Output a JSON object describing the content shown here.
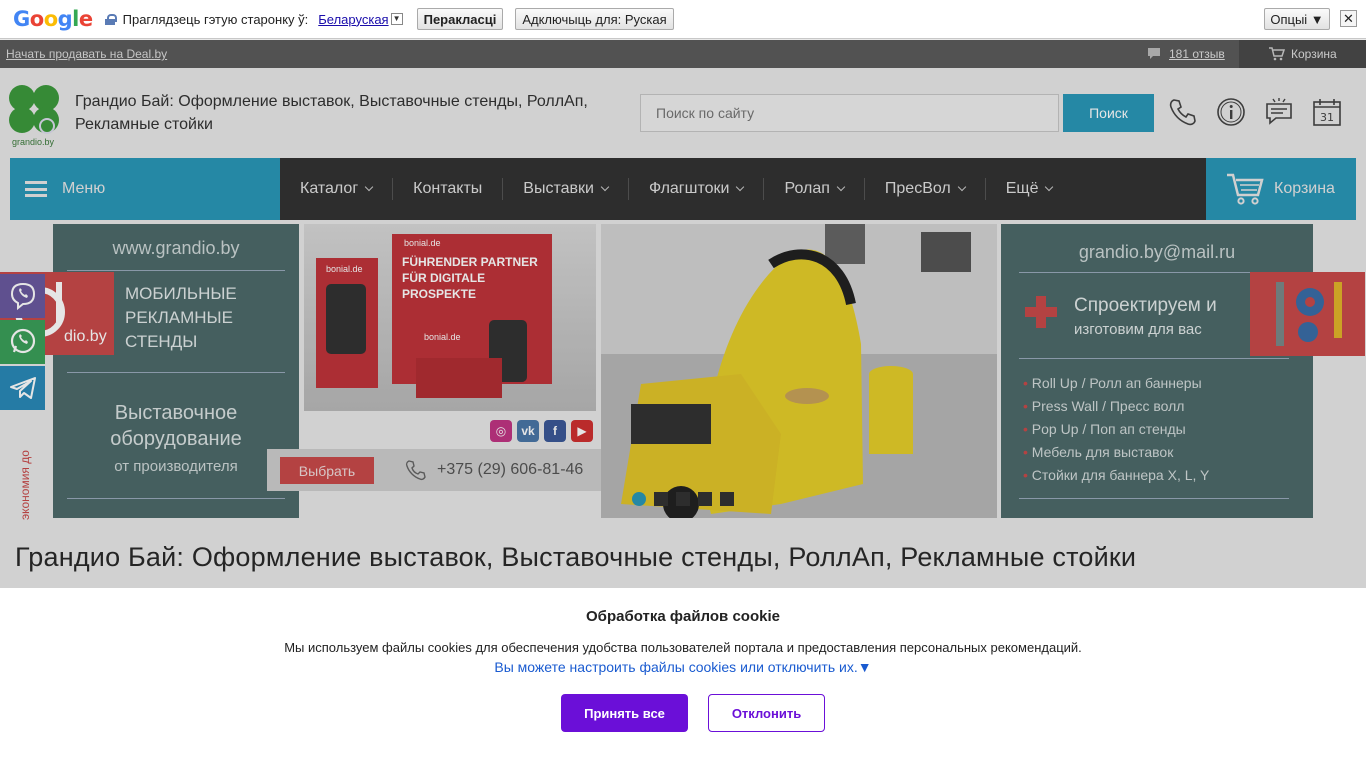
{
  "translate_bar": {
    "logo": "Google",
    "prompt": "Праглядзець гэтую старонку ў:",
    "language": "Беларуская",
    "translate_btn": "Перакласці",
    "disable_btn": "Адключыць для: Руская",
    "options_btn": "Опцыі ▼",
    "close": "✕"
  },
  "top_strip": {
    "sell_link": "Начать продавать на Deal.by",
    "reviews": "181 отзыв",
    "cart": "Корзина"
  },
  "header": {
    "logo_caption": "grandio.by",
    "title": "Грандио Бай: Оформление выставок, Выставочные стенды, РоллАп, Рекламные стойки",
    "search_placeholder": "Поиск по сайту",
    "search_button": "Поиск",
    "calendar_day": "31"
  },
  "nav": {
    "menu": "Меню",
    "items": [
      {
        "label": "Каталог",
        "dropdown": true
      },
      {
        "label": "Контакты",
        "dropdown": false
      },
      {
        "label": "Выставки",
        "dropdown": true
      },
      {
        "label": "Флагштоки",
        "dropdown": true
      },
      {
        "label": "Ролап",
        "dropdown": true
      },
      {
        "label": "ПресВол",
        "dropdown": true
      },
      {
        "label": "Ещё",
        "dropdown": true
      }
    ],
    "cart": "Корзина"
  },
  "banner": {
    "left_url": "www.grandio.by",
    "logo_text": "dio.by",
    "mobile": [
      "МОБИЛЬНЫЕ",
      "РЕКЛАМНЫЕ",
      "СТЕНДЫ"
    ],
    "equip_line1": "Выставочное",
    "equip_line2": "оборудование",
    "equip_line3": "от производителя",
    "photo_brand": "bonial.de",
    "photo_headline": "FÜHRENDER PARTNER FÜR DIGITALE PROSPEKTE",
    "cta": "Выбрать",
    "phone": "+375 (29) 606-81-46",
    "side_text": "экономия до",
    "right_email": "grandio.by@mail.ru",
    "proj_line1": "Спроектируем и",
    "proj_line2": "изготовим для вас",
    "services": [
      "Roll Up / Ролл ап баннеры",
      "Press Wall / Пресс волл",
      "Pop Up / Поп ап стенды",
      "Мебель для выставок",
      "Стойки для баннера X, L, Y"
    ],
    "slides": 5,
    "active_slide": 1
  },
  "page_title": "Грандио Бай: Оформление выставок, Выставочные стенды, РоллАп, Рекламные стойки",
  "cookie": {
    "title": "Обработка файлов cookie",
    "text": "Мы используем файлы cookies для обеспечения удобства пользователей портала и предоставления персональных рекомендаций.",
    "link": "Вы можете настроить файлы cookies или отключить их.▼",
    "accept": "Принять все",
    "decline": "Отклонить"
  },
  "colors": {
    "accent": "#2a98b8",
    "nav_dark": "#333333",
    "banner_teal": "#4d6a6a",
    "banner_red": "#c94a4a",
    "cookie_purple": "#6b0fd8"
  }
}
